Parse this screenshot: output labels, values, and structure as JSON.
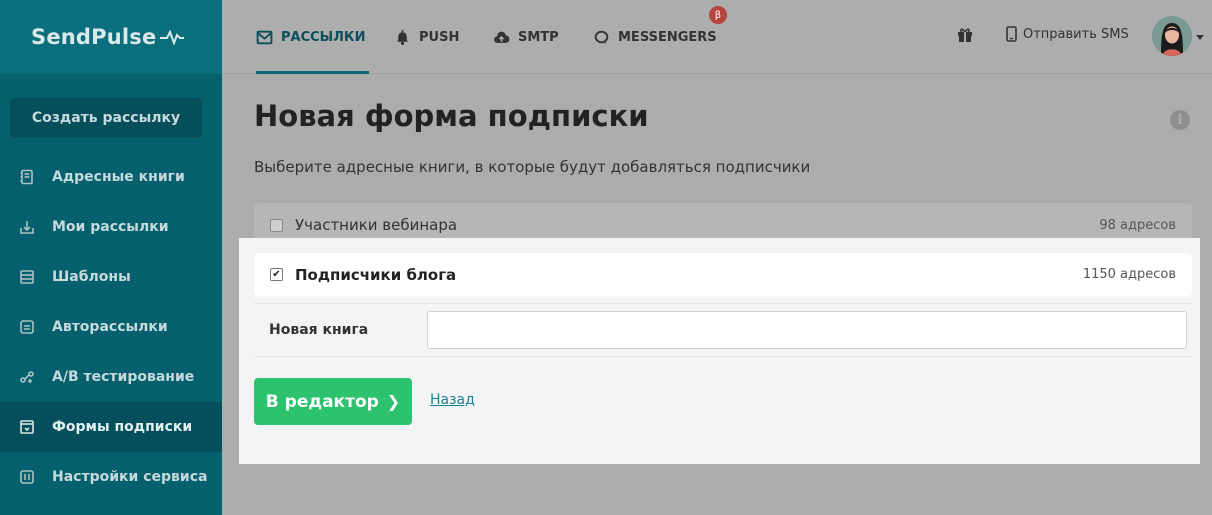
{
  "app": {
    "logo": "SendPulse"
  },
  "sidebar": {
    "create_button": "Создать рассылку",
    "items": [
      {
        "label": "Адресные книги",
        "icon": "address-book-icon"
      },
      {
        "label": "Мои рассылки",
        "icon": "mailing-icon"
      },
      {
        "label": "Шаблоны",
        "icon": "templates-icon"
      },
      {
        "label": "Авторассылки",
        "icon": "automation-icon"
      },
      {
        "label": "A/B тестирование",
        "icon": "ab-test-icon"
      },
      {
        "label": "Формы подписки",
        "icon": "subscription-form-icon",
        "active": true
      },
      {
        "label": "Настройки сервиса",
        "icon": "settings-icon"
      }
    ]
  },
  "topbar": {
    "tabs": [
      {
        "label": "РАССЫЛКИ",
        "icon": "mail-icon",
        "active": true
      },
      {
        "label": "PUSH",
        "icon": "bell-icon"
      },
      {
        "label": "SMTP",
        "icon": "cloud-upload-icon"
      },
      {
        "label": "MESSENGERS",
        "icon": "chat-icon"
      }
    ],
    "beta_badge": "β",
    "sms_label": "Отправить SMS"
  },
  "main": {
    "title": "Новая форма подписки",
    "subtitle": "Выберите адресные книги, в которые будут добавляться подписчики",
    "books": [
      {
        "name": "Участники вебинара",
        "count": "98 адресов",
        "checked": false
      },
      {
        "name": "Подписчики блога",
        "count": "1150 адресов",
        "checked": true
      }
    ],
    "new_book_label": "Новая книга",
    "new_book_value": "",
    "editor_button": "В редактор",
    "back_link": "Назад"
  },
  "colors": {
    "sidebar_bg": "#05606e",
    "accent_green": "#2cc26e",
    "link": "#1a8596",
    "beta_red": "#b7443f"
  }
}
